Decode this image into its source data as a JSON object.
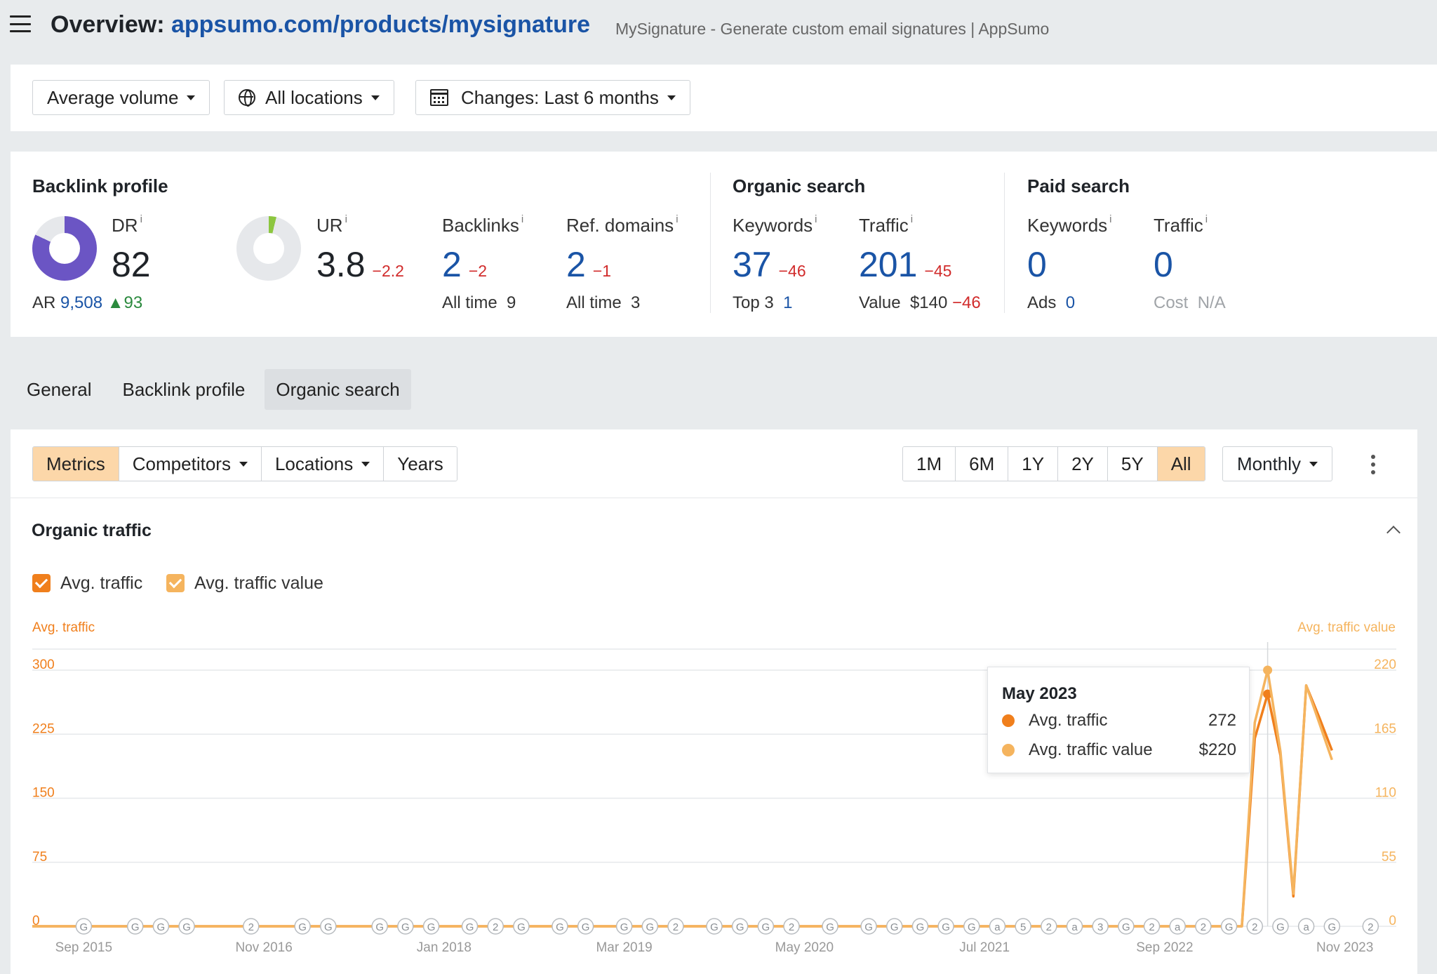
{
  "header": {
    "title_prefix": "Overview:",
    "url": "appsumo.com/products/mysignature",
    "page_title": "MySignature - Generate custom email signatures | AppSumo"
  },
  "filters": {
    "volume": "Average volume",
    "locations": "All locations",
    "changes": "Changes: Last 6 months"
  },
  "backlink_profile": {
    "title": "Backlink profile",
    "dr": {
      "label": "DR",
      "value": "82",
      "fill": 0.82
    },
    "ar_label": "AR",
    "ar_value": "9,508",
    "ar_delta": "93",
    "ur": {
      "label": "UR",
      "value": "3.8",
      "delta": "−2.2",
      "fill": 0.038
    },
    "backlinks": {
      "label": "Backlinks",
      "value": "2",
      "delta": "−2",
      "sub_label": "All time",
      "sub_value": "9"
    },
    "ref_domains": {
      "label": "Ref. domains",
      "value": "2",
      "delta": "−1",
      "sub_label": "All time",
      "sub_value": "3"
    }
  },
  "organic_search": {
    "title": "Organic search",
    "keywords": {
      "label": "Keywords",
      "value": "37",
      "delta": "−46",
      "sub_label": "Top 3",
      "sub_value": "1"
    },
    "traffic": {
      "label": "Traffic",
      "value": "201",
      "delta": "−45",
      "sub_label": "Value",
      "sub_value": "$140",
      "sub_delta": "−46"
    }
  },
  "paid_search": {
    "title": "Paid search",
    "keywords": {
      "label": "Keywords",
      "value": "0",
      "sub_label": "Ads",
      "sub_value": "0"
    },
    "traffic": {
      "label": "Traffic",
      "value": "0",
      "sub_label": "Cost",
      "sub_value": "N/A"
    }
  },
  "info_mark": "i",
  "tabs": [
    "General",
    "Backlink profile",
    "Organic search"
  ],
  "active_tab": "Organic search",
  "controls": {
    "left": [
      "Metrics",
      "Competitors",
      "Locations",
      "Years"
    ],
    "left_dropdowns": [
      "Competitors",
      "Locations"
    ],
    "selected_left": "Metrics",
    "ranges": [
      "1M",
      "6M",
      "1Y",
      "2Y",
      "5Y",
      "All"
    ],
    "selected_range": "All",
    "granularity": "Monthly"
  },
  "chart_panel": {
    "title": "Organic traffic",
    "legend": [
      "Avg. traffic",
      "Avg. traffic value"
    ]
  },
  "tooltip": {
    "title": "May 2023",
    "rows": [
      {
        "label": "Avg. traffic",
        "value": "272"
      },
      {
        "label": "Avg. traffic value",
        "value": "$220"
      }
    ]
  },
  "colors": {
    "accent_orange": "#f07f1c",
    "light_orange": "#f5b45e",
    "link_blue": "#1a54a6",
    "negative_red": "#d12c2c",
    "positive_green": "#2b8a3e",
    "dr_purple": "#6b55c4",
    "ur_green": "#8cc63f"
  },
  "chart_data": {
    "type": "line",
    "title": "",
    "ylabel_left": "Avg. traffic",
    "ylabel_right": "Avg. traffic value",
    "ylim_left": [
      0,
      300
    ],
    "ylim_right": [
      0,
      220
    ],
    "yticks_left": [
      0,
      75,
      150,
      225,
      300
    ],
    "yticks_right": [
      0,
      55,
      110,
      165,
      220
    ],
    "xlim": [
      "2015-05",
      "2024-03"
    ],
    "xtick_labels": [
      {
        "date": "2015-09",
        "label": "Sep 2015"
      },
      {
        "date": "2016-11",
        "label": "Nov 2016"
      },
      {
        "date": "2018-01",
        "label": "Jan 2018"
      },
      {
        "date": "2019-03",
        "label": "Mar 2019"
      },
      {
        "date": "2020-05",
        "label": "May 2020"
      },
      {
        "date": "2021-07",
        "label": "Jul 2021"
      },
      {
        "date": "2022-09",
        "label": "Sep 2022"
      },
      {
        "date": "2023-11",
        "label": "Nov 2023"
      }
    ],
    "grid": true,
    "series": [
      {
        "name": "Avg. traffic",
        "axis": "left",
        "color": "#f07f1c",
        "points": [
          {
            "x": "2015-05",
            "y": 0
          },
          {
            "x": "2023-03",
            "y": 0
          },
          {
            "x": "2023-04",
            "y": 220
          },
          {
            "x": "2023-05",
            "y": 272
          },
          {
            "x": "2023-06",
            "y": 200
          },
          {
            "x": "2023-07",
            "y": 35
          },
          {
            "x": "2023-08",
            "y": 282
          },
          {
            "x": "2023-09",
            "y": 245
          },
          {
            "x": "2023-10",
            "y": 206
          }
        ]
      },
      {
        "name": "Avg. traffic value",
        "axis": "right",
        "color": "#f5b45e",
        "points": [
          {
            "x": "2015-05",
            "y": 0
          },
          {
            "x": "2023-03",
            "y": 0
          },
          {
            "x": "2023-04",
            "y": 175
          },
          {
            "x": "2023-05",
            "y": 220
          },
          {
            "x": "2023-06",
            "y": 150
          },
          {
            "x": "2023-07",
            "y": 28
          },
          {
            "x": "2023-08",
            "y": 207
          },
          {
            "x": "2023-09",
            "y": 175
          },
          {
            "x": "2023-10",
            "y": 143
          }
        ]
      }
    ],
    "hover": {
      "x": "2023-05"
    },
    "annotations": [
      {
        "x": "2015-09",
        "label": "G"
      },
      {
        "x": "2016-01",
        "label": "G"
      },
      {
        "x": "2016-03",
        "label": "G"
      },
      {
        "x": "2016-05",
        "label": "G"
      },
      {
        "x": "2016-10",
        "label": "2"
      },
      {
        "x": "2017-02",
        "label": "G"
      },
      {
        "x": "2017-04",
        "label": "G"
      },
      {
        "x": "2017-08",
        "label": "G"
      },
      {
        "x": "2017-10",
        "label": "G"
      },
      {
        "x": "2017-12",
        "label": "G"
      },
      {
        "x": "2018-03",
        "label": "G"
      },
      {
        "x": "2018-05",
        "label": "2"
      },
      {
        "x": "2018-07",
        "label": "G"
      },
      {
        "x": "2018-10",
        "label": "G"
      },
      {
        "x": "2018-12",
        "label": "G"
      },
      {
        "x": "2019-03",
        "label": "G"
      },
      {
        "x": "2019-05",
        "label": "G"
      },
      {
        "x": "2019-07",
        "label": "2"
      },
      {
        "x": "2019-10",
        "label": "G"
      },
      {
        "x": "2019-12",
        "label": "G"
      },
      {
        "x": "2020-02",
        "label": "G"
      },
      {
        "x": "2020-04",
        "label": "2"
      },
      {
        "x": "2020-07",
        "label": "G"
      },
      {
        "x": "2020-10",
        "label": "G"
      },
      {
        "x": "2020-12",
        "label": "G"
      },
      {
        "x": "2021-02",
        "label": "G"
      },
      {
        "x": "2021-04",
        "label": "G"
      },
      {
        "x": "2021-06",
        "label": "G"
      },
      {
        "x": "2021-08",
        "label": "a"
      },
      {
        "x": "2021-10",
        "label": "5"
      },
      {
        "x": "2021-12",
        "label": "2"
      },
      {
        "x": "2022-02",
        "label": "a"
      },
      {
        "x": "2022-04",
        "label": "3"
      },
      {
        "x": "2022-06",
        "label": "G"
      },
      {
        "x": "2022-08",
        "label": "2"
      },
      {
        "x": "2022-10",
        "label": "a"
      },
      {
        "x": "2022-12",
        "label": "2"
      },
      {
        "x": "2023-02",
        "label": "G"
      },
      {
        "x": "2023-04",
        "label": "2"
      },
      {
        "x": "2023-06",
        "label": "G"
      },
      {
        "x": "2023-08",
        "label": "a"
      },
      {
        "x": "2023-10",
        "label": "G"
      },
      {
        "x": "2024-01",
        "label": "2"
      }
    ]
  }
}
